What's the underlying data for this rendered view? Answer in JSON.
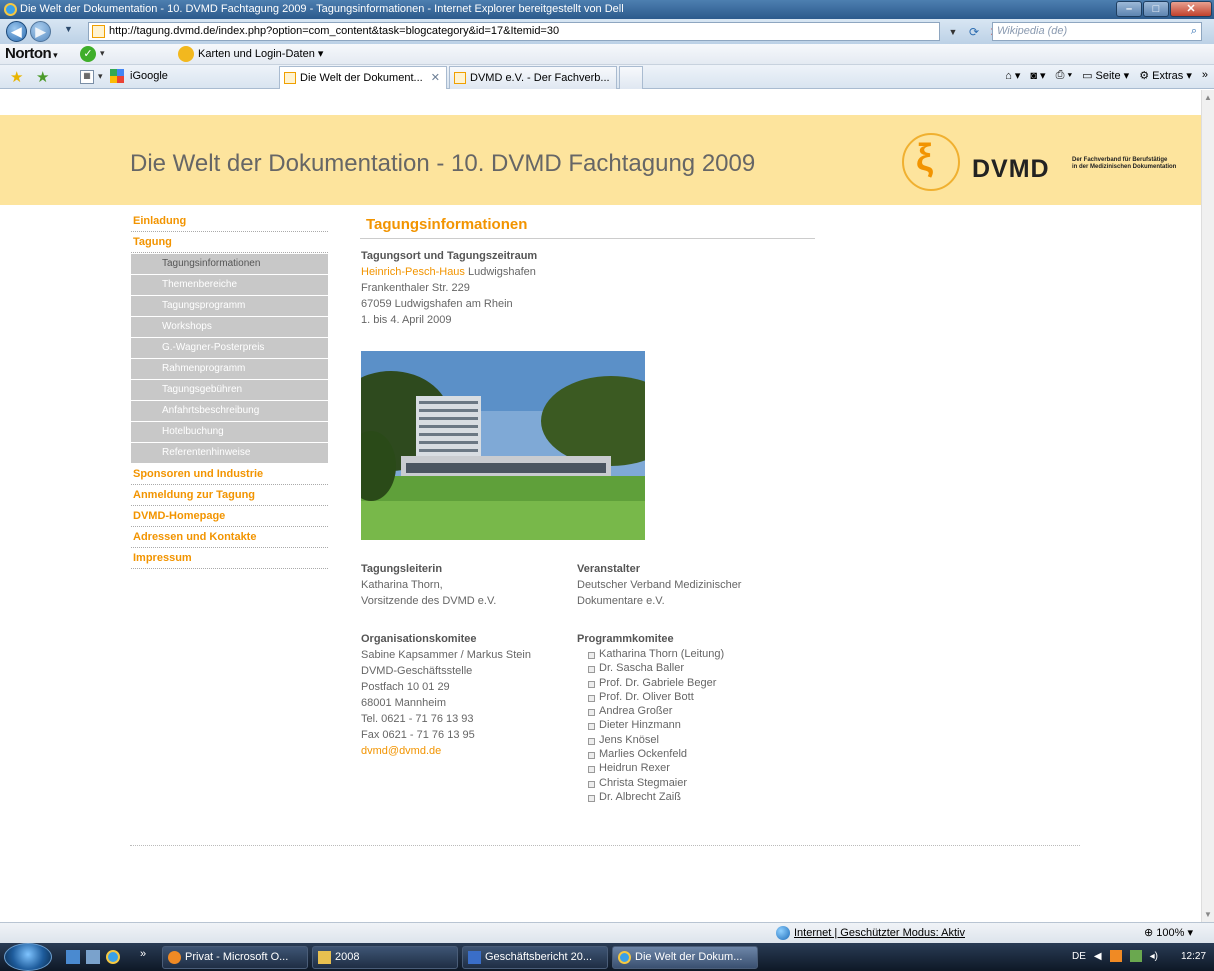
{
  "window": {
    "title": "Die Welt der Dokumentation - 10. DVMD Fachtagung 2009 - Tagungsinformationen - Internet Explorer bereitgestellt von Dell"
  },
  "browser": {
    "url": "http://tagung.dvmd.de/index.php?option=com_content&task=blogcategory&id=17&Itemid=30",
    "search_placeholder": "Wikipedia (de)",
    "norton_label": "Norton",
    "norton_logins": "Karten und Login-Daten",
    "tabs": [
      {
        "label": "iGoogle"
      },
      {
        "label": "Die Welt der Dokument..."
      },
      {
        "label": "DVMD e.V. - Der Fachverb..."
      }
    ],
    "cmd": {
      "page": "Seite",
      "extras": "Extras"
    },
    "status_zone": "Internet | Geschützter Modus: Aktiv",
    "zoom": "100%"
  },
  "site": {
    "title": "Die Welt der Dokumentation - 10. DVMD Fachtagung 2009",
    "logo_text": "DVMD",
    "logo_tagline_1": "Der Fachverband für Berufstätige",
    "logo_tagline_2": "in der Medizinischen Dokumentation"
  },
  "menu": {
    "einladung": "Einladung",
    "tagung": "Tagung",
    "sub": [
      "Tagungsinformationen",
      "Themenbereiche",
      "Tagungsprogramm",
      "Workshops",
      "G.-Wagner-Posterpreis",
      "Rahmenprogramm",
      "Tagungsgebühren",
      "Anfahrtsbeschreibung",
      "Hotelbuchung",
      "Referentenhinweise"
    ],
    "sponsoren": "Sponsoren und Industrie",
    "anmeldung": "Anmeldung zur Tagung",
    "homepage": "DVMD-Homepage",
    "adressen": "Adressen und Kontakte",
    "impressum": "Impressum"
  },
  "content": {
    "heading": "Tagungsinformationen",
    "venue": {
      "title": "Tagungsort und Tagungszeitraum",
      "link": "Heinrich-Pesch-Haus",
      "city": " Ludwigshafen",
      "street": "Frankenthaler Str. 229",
      "zip_city": "67059 Ludwigshafen am Rhein",
      "dates": "1. bis 4. April 2009"
    },
    "leader": {
      "title": "Tagungsleiterin",
      "name": "Katharina Thorn,",
      "role": "Vorsitzende des DVMD e.V."
    },
    "organizer": {
      "title": "Veranstalter",
      "line1": "Deutscher Verband Medizinischer",
      "line2": "Dokumentare e.V."
    },
    "orga": {
      "title": "Organisationskomitee",
      "names": "Sabine Kapsammer / Markus Stein",
      "office": "DVMD-Geschäftsstelle",
      "po": "Postfach 10 01 29",
      "city": "68001 Mannheim",
      "tel": "Tel. 0621 - 71 76 13 93",
      "fax": "Fax 0621 - 71 76 13 95",
      "email": "dvmd@dvmd.de"
    },
    "program": {
      "title": "Programmkomitee",
      "members": [
        "Katharina Thorn (Leitung)",
        "Dr. Sascha Baller",
        "Prof. Dr. Gabriele Beger",
        "Prof. Dr. Oliver Bott",
        "Andrea Großer",
        "Dieter Hinzmann",
        "Jens Knösel",
        "Marlies Ockenfeld",
        "Heidrun Rexer",
        "Christa Stegmaier",
        "Dr. Albrecht Zaiß"
      ]
    }
  },
  "taskbar": {
    "items": [
      {
        "label": "Privat - Microsoft O..."
      },
      {
        "label": "2008"
      },
      {
        "label": "Geschäftsbericht 20..."
      },
      {
        "label": "Die Welt der Dokum..."
      }
    ],
    "lang": "DE",
    "time": "12:27"
  }
}
